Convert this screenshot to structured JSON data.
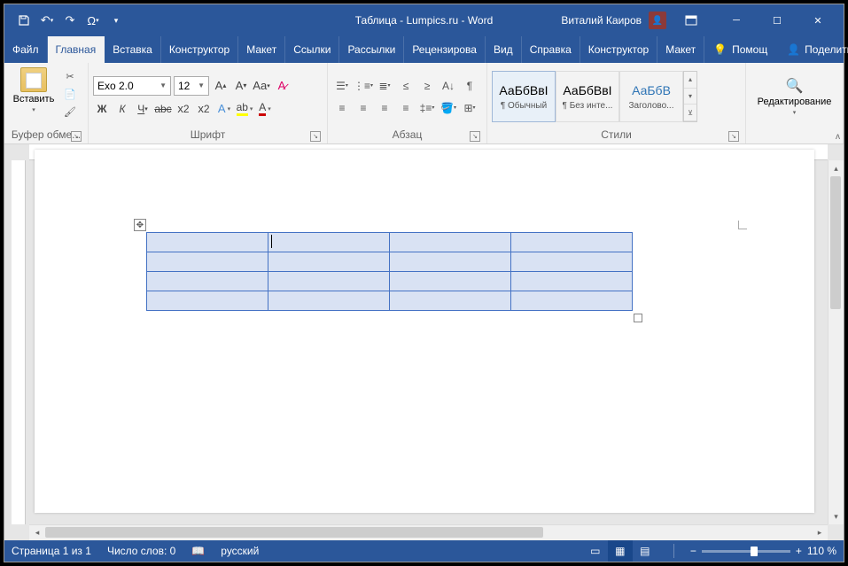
{
  "title": "Таблица - Lumpics.ru - Word",
  "user": "Виталий Каиров",
  "tabs": {
    "file": "Файл",
    "home": "Главная",
    "insert": "Вставка",
    "design": "Конструктор",
    "layout": "Макет",
    "refs": "Ссылки",
    "mail": "Рассылки",
    "review": "Рецензирова",
    "view": "Вид",
    "help": "Справка",
    "tdesign": "Конструктор",
    "tlayout": "Макет",
    "tell": "Помощ",
    "share": "Поделиться"
  },
  "ribbon": {
    "clipboard": {
      "paste": "Вставить",
      "label": "Буфер обме..."
    },
    "font": {
      "name": "Exo 2.0",
      "size": "12",
      "label": "Шрифт"
    },
    "para": {
      "label": "Абзац"
    },
    "styles": {
      "label": "Стили",
      "s1": {
        "preview": "АаБбВвІ",
        "name": "¶ Обычный"
      },
      "s2": {
        "preview": "АаБбВвІ",
        "name": "¶ Без инте..."
      },
      "s3": {
        "preview": "АаБбВ",
        "name": "Заголово..."
      }
    },
    "editing": {
      "label": "Редактирование"
    }
  },
  "status": {
    "page": "Страница 1 из 1",
    "words": "Число слов: 0",
    "lang": "русский",
    "zoom": "110 %"
  }
}
